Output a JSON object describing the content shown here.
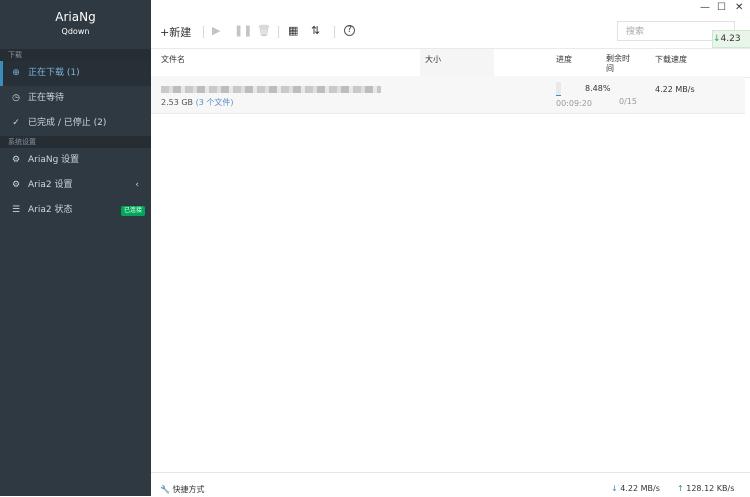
{
  "app": {
    "title": "AriaNg",
    "subtitle": "Qdown"
  },
  "sidebar": {
    "section_download": "下载",
    "section_settings": "系统设置",
    "downloading": "正在下载 (1)",
    "waiting": "正在等待",
    "stopped": "已完成 / 已停止 (2)",
    "ariang_settings": "AriaNg 设置",
    "aria2_settings": "Aria2 设置",
    "aria2_status": "Aria2 状态",
    "connected_badge": "已连接",
    "caret": "‹"
  },
  "window": {
    "minimize": "—",
    "maximize": "☐",
    "close": "✕"
  },
  "toolbar": {
    "new_label": "新建",
    "search_placeholder": "搜索",
    "help": "?"
  },
  "speed_tag": "4.23",
  "table": {
    "headers": {
      "name": "文件名",
      "size": "大小",
      "progress": "进度",
      "remaining": "剩余时间",
      "speed": "下载速度"
    }
  },
  "task": {
    "size": "2.53 GB",
    "files": "(3 个文件)",
    "progress_percent": 8.48,
    "progress_text": "8.48%",
    "elapsed": "00:09:20",
    "connections": "0/15",
    "speed": "4.22 MB/s"
  },
  "footer": {
    "shortcut": "快捷方式",
    "down_speed": "4.22 MB/s",
    "up_speed": "128.12 KB/s"
  },
  "colors": {
    "sidebar_bg": "#2f3941",
    "accent": "#3c8dbc",
    "badge": "#00a65a"
  }
}
